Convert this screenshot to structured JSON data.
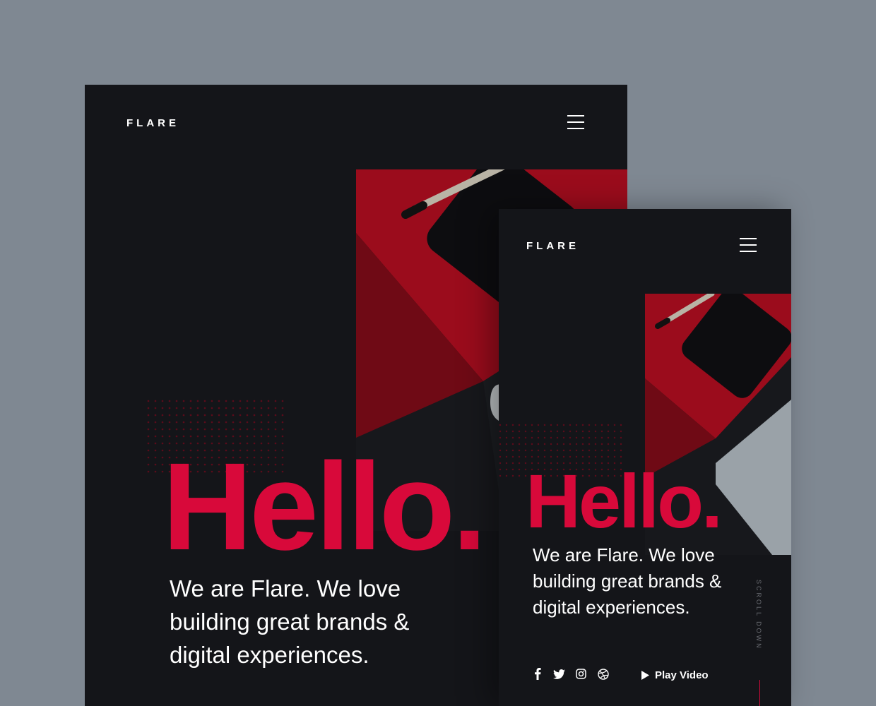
{
  "colors": {
    "background": "#7f8892",
    "panel": "#141519",
    "accent": "#d8093a",
    "text": "#ffffff",
    "muted": "#6b6d73"
  },
  "tablet": {
    "logo": "FLARE",
    "menu_icon": "hamburger-menu-icon",
    "hero_heading": "Hello.",
    "tagline": "We are Flare. We love building great brands & digital experiences."
  },
  "phone": {
    "logo": "FLARE",
    "menu_icon": "hamburger-menu-icon",
    "hero_heading": "Hello.",
    "tagline": "We are Flare. We love building great brands & digital experiences.",
    "socials": [
      "facebook-icon",
      "twitter-icon",
      "instagram-icon",
      "dribbble-icon"
    ],
    "play_label": "Play Video",
    "scroll_label": "SCROLL DOWN"
  }
}
